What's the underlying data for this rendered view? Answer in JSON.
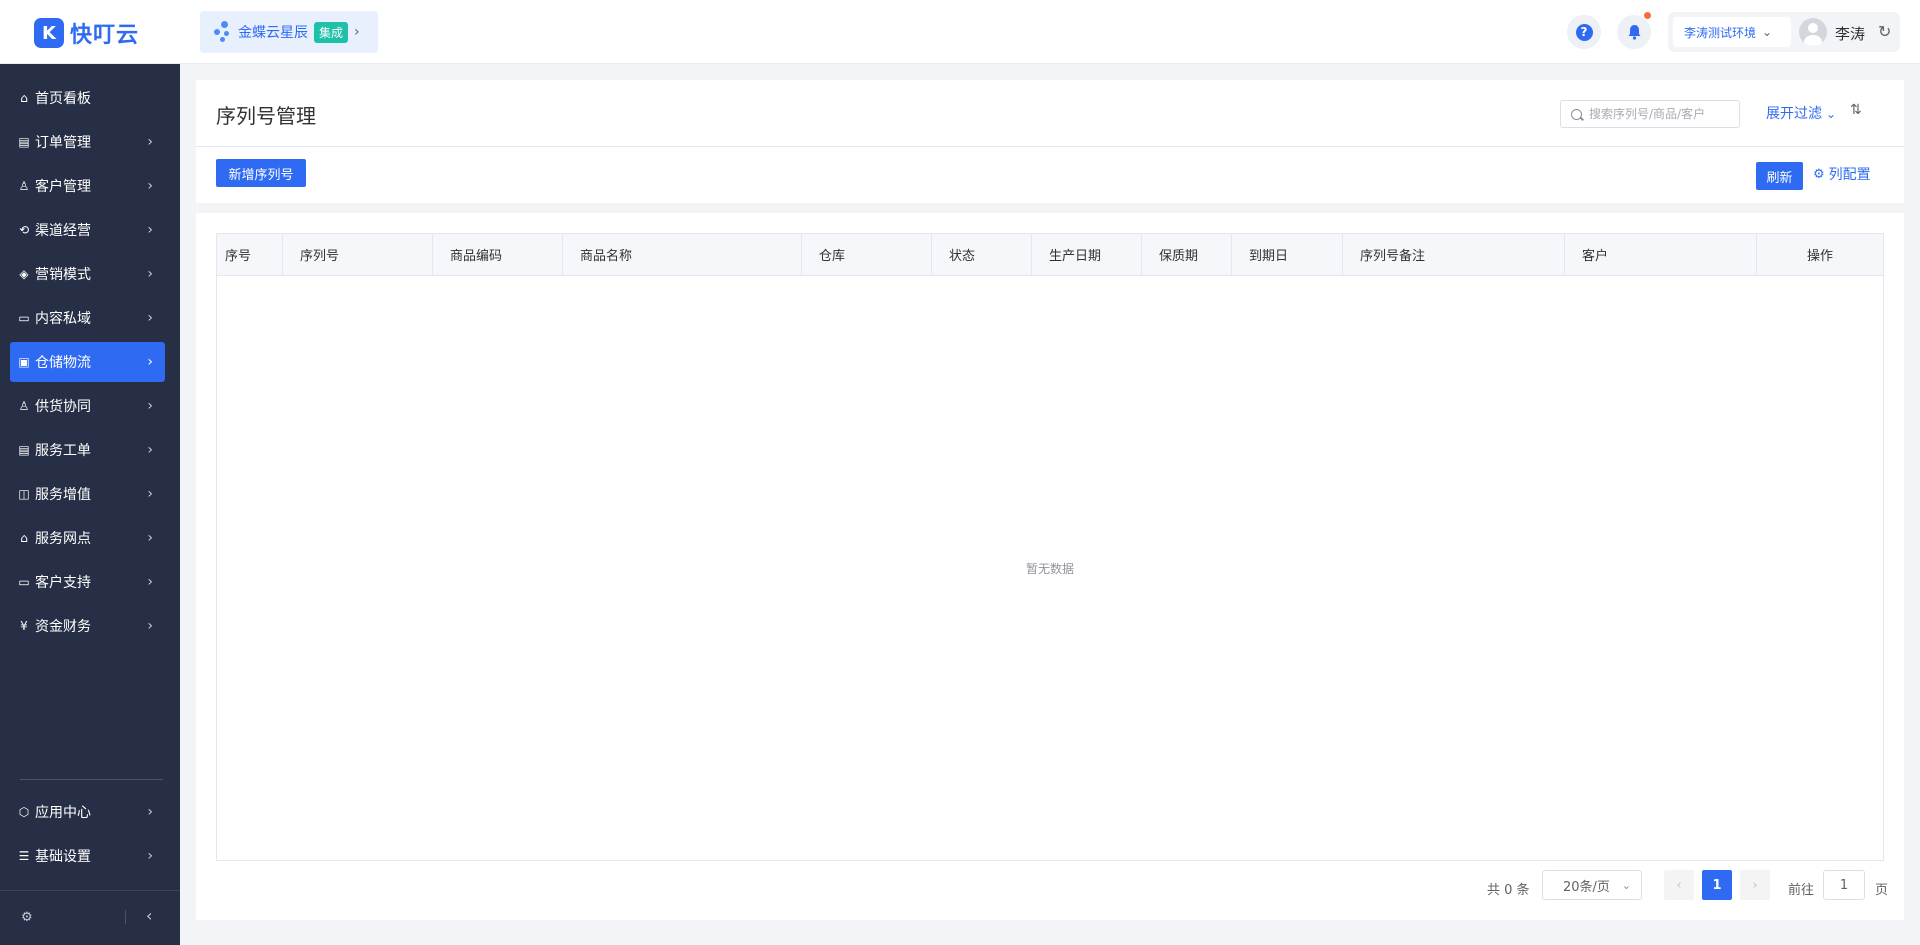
{
  "header": {
    "logo_text": "快叮云",
    "integration_label": "金蝶云星辰",
    "integration_tag": "集成",
    "env_label": "李涛测试环境",
    "user_name": "李涛"
  },
  "sidebar": {
    "items": [
      {
        "label": "首页看板",
        "icon": "home-icon"
      },
      {
        "label": "订单管理",
        "icon": "order-icon"
      },
      {
        "label": "客户管理",
        "icon": "user-icon"
      },
      {
        "label": "渠道经营",
        "icon": "channel-icon"
      },
      {
        "label": "营销模式",
        "icon": "tag-icon"
      },
      {
        "label": "内容私域",
        "icon": "image-icon"
      },
      {
        "label": "仓储物流",
        "icon": "warehouse-icon"
      },
      {
        "label": "供货协同",
        "icon": "supply-icon"
      },
      {
        "label": "服务工单",
        "icon": "ticket-icon"
      },
      {
        "label": "服务增值",
        "icon": "bag-icon"
      },
      {
        "label": "服务网点",
        "icon": "store-icon"
      },
      {
        "label": "客户支持",
        "icon": "support-icon"
      },
      {
        "label": "资金财务",
        "icon": "yen-icon"
      }
    ],
    "bottom_items": [
      {
        "label": "应用中心",
        "icon": "cube-icon"
      },
      {
        "label": "基础设置",
        "icon": "sliders-icon"
      }
    ],
    "active_index": 6
  },
  "page": {
    "title": "序列号管理",
    "search_placeholder": "搜索序列号/商品/客户",
    "expand_filter": "展开过滤",
    "add_button": "新增序列号",
    "refresh_button": "刷新",
    "column_config": "列配置"
  },
  "table": {
    "columns": [
      "序号",
      "序列号",
      "商品编码",
      "商品名称",
      "仓库",
      "状态",
      "生产日期",
      "保质期",
      "到期日",
      "序列号备注",
      "客户",
      "操作"
    ],
    "empty_text": "暂无数据"
  },
  "pagination": {
    "total": "共 0 条",
    "page_size": "20条/页",
    "current_page": "1",
    "goto_label": "前往",
    "goto_value": "1",
    "page_unit": "页"
  },
  "colors": {
    "primary": "#2f6bf2",
    "sidebar_bg": "#262f45",
    "tag_green": "#1ec1a7"
  }
}
